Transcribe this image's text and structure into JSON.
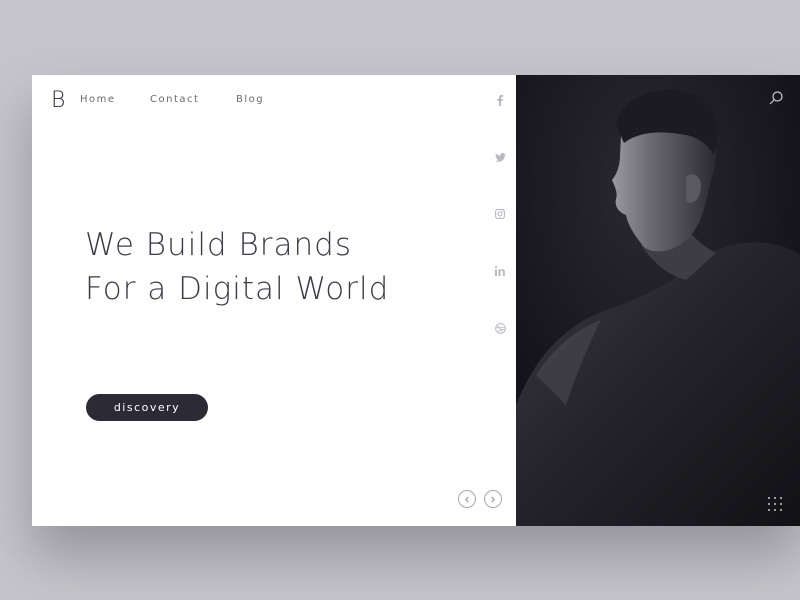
{
  "brand": {
    "logo_letter": "B"
  },
  "nav": {
    "items": [
      {
        "label": "Home"
      },
      {
        "label": "Contact"
      },
      {
        "label": "Blog"
      }
    ]
  },
  "social": {
    "icons": [
      "facebook-icon",
      "twitter-icon",
      "instagram-icon",
      "linkedin-icon",
      "dribbble-icon"
    ]
  },
  "hero": {
    "headline_line1": "We Build Brands",
    "headline_line2": "For a Digital World",
    "cta_label": "discovery"
  },
  "colors": {
    "page_bg": "#c6c5cb",
    "card_bg": "#ffffff",
    "dark_panel": "#17161d",
    "text_dark": "#3a3948",
    "button_bg": "#2b2a35",
    "muted": "#b9b8c0"
  }
}
